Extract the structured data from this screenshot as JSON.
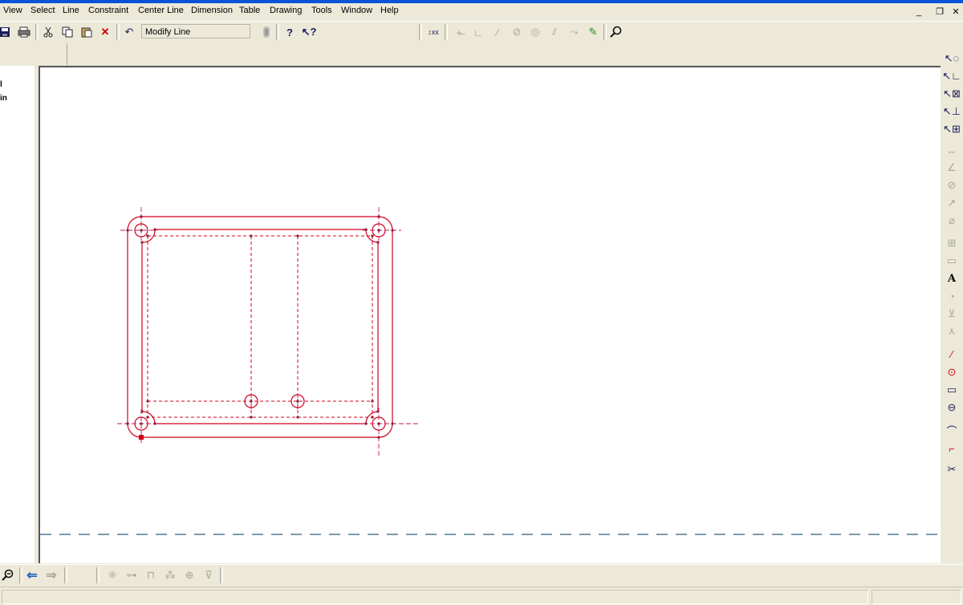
{
  "menu": {
    "items": [
      "View",
      "Select",
      "Line",
      "Constraint",
      "Center Line",
      "Dimension",
      "Table",
      "Drawing",
      "Tools",
      "Window",
      "Help"
    ]
  },
  "window_controls": {
    "minimize": "_",
    "restore": "❐",
    "close": "✕"
  },
  "toolbar": {
    "command_field_value": "Modify Line",
    "icons": [
      "save-icon",
      "print-icon",
      "cut-icon",
      "copy-icon",
      "paste-icon",
      "delete-icon",
      "undo-icon",
      "layer-icon",
      "help-icon",
      "whats-this-icon"
    ],
    "constraint_icons": [
      "dimension-xx-icon",
      "horizontal-icon",
      "perpendicular-icon",
      "parallel-icon",
      "tangent-icon",
      "concentric-icon",
      "equal-icon",
      "symmetry-icon",
      "solve-icon",
      "zoom-icon"
    ]
  },
  "left_panel": {
    "line1": "l",
    "line2": "in"
  },
  "right_toolbar": {
    "icons": [
      "select-arc-icon",
      "select-corner-icon",
      "select-box-icon",
      "select-dim-icon",
      "select-group-icon",
      "dim-horizontal-icon",
      "dim-angle-icon",
      "dim-radius-icon",
      "dim-label-icon",
      "dim-diameter-icon",
      "table-icon",
      "note-box-icon",
      "text-icon",
      "balloon-icon",
      "weld-icon",
      "surface-icon",
      "line-tool-icon",
      "circle-tool-icon",
      "rectangle-tool-icon",
      "ellipse-tool-icon",
      "arc-tool-icon",
      "fillet-tool-icon",
      "trim-tool-icon"
    ]
  },
  "bottom_toolbar": {
    "icons": [
      "zoom-out-icon",
      "back-arrow-icon",
      "forward-arrow-icon",
      "node-icon",
      "connector-icon",
      "pin-icon",
      "cluster-icon",
      "target-icon",
      "funnel-icon"
    ]
  },
  "colors": {
    "sketch": "#d0021b",
    "construction": "#8b1a3a",
    "canvas_bg": "#ffffff",
    "chrome": "#ece9d8",
    "titlebar": "#0a53d6",
    "baseline": "#2b5d7a"
  }
}
